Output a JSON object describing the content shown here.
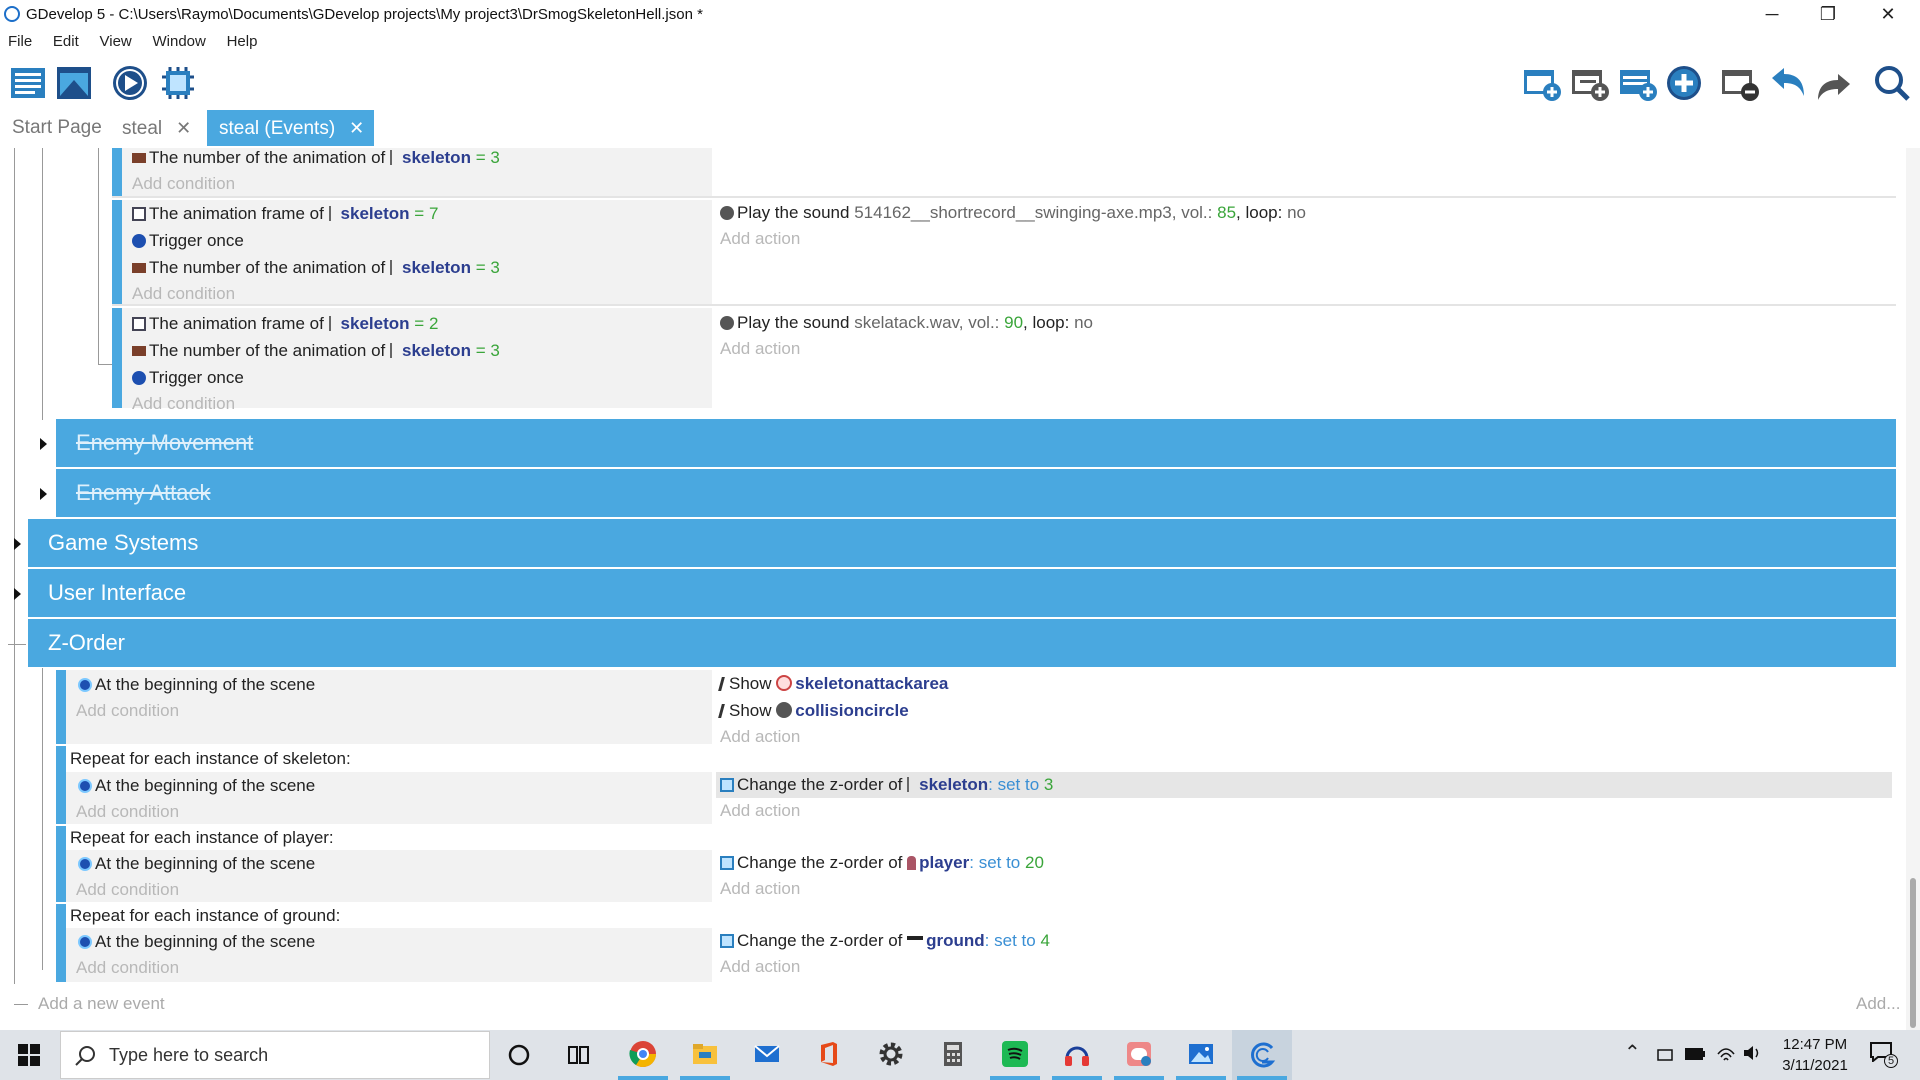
{
  "window": {
    "title": "GDevelop 5 - C:\\Users\\Raymo\\Documents\\GDevelop projects\\My project3\\DrSmogSkeletonHell.json *",
    "minimize": "─",
    "restore": "❐",
    "close": "✕"
  },
  "menu": [
    "File",
    "Edit",
    "View",
    "Window",
    "Help"
  ],
  "tabs": [
    {
      "label": "Start Page"
    },
    {
      "label": "steal",
      "close": "✕"
    },
    {
      "label": "steal (Events)",
      "close": "✕"
    }
  ],
  "accent": "#4aa8e0",
  "common": {
    "add_condition": "Add condition",
    "add_action": "Add action",
    "add_new_event": "Add a new event",
    "add": "Add...",
    "at_beginning": "At the beginning of the scene",
    "trigger_once": "Trigger once",
    "num_anim": "The number of the animation of",
    "anim_frame": "The animation frame of",
    "play_sound": "Play the sound",
    "vol": ", vol.:",
    "loop": ", loop:",
    "no": "no",
    "eq": "=",
    "show": "Show",
    "change_z": "Change the z-order of",
    "set_to": "set to",
    "colon": ":"
  },
  "objects": {
    "skeleton": "skeleton",
    "player": "player",
    "ground": "ground",
    "skeletonattackarea": "skeletonattackarea",
    "collisioncircle": "collisioncircle"
  },
  "events": {
    "e1": {
      "value": "3"
    },
    "e2": {
      "frame": "7",
      "anim": "3",
      "sound": "514162__shortrecord__swinging-axe.mp3",
      "vol": "85"
    },
    "e3": {
      "frame": "2",
      "anim": "3",
      "sound": "skelatack.wav",
      "vol": "90"
    },
    "groups": [
      "Enemy Movement",
      "Enemy Attack",
      "Game Systems",
      "User Interface",
      "Z-Order"
    ],
    "repeat_skeleton": "Repeat for each instance of skeleton:",
    "repeat_player": "Repeat for each instance of player:",
    "repeat_ground": "Repeat for each instance of ground:",
    "z_skeleton": "3",
    "z_player": "20",
    "z_ground": "4"
  },
  "taskbar": {
    "search_placeholder": "Type here to search",
    "time": "12:47 PM",
    "date": "3/11/2021",
    "notifications": "5"
  }
}
